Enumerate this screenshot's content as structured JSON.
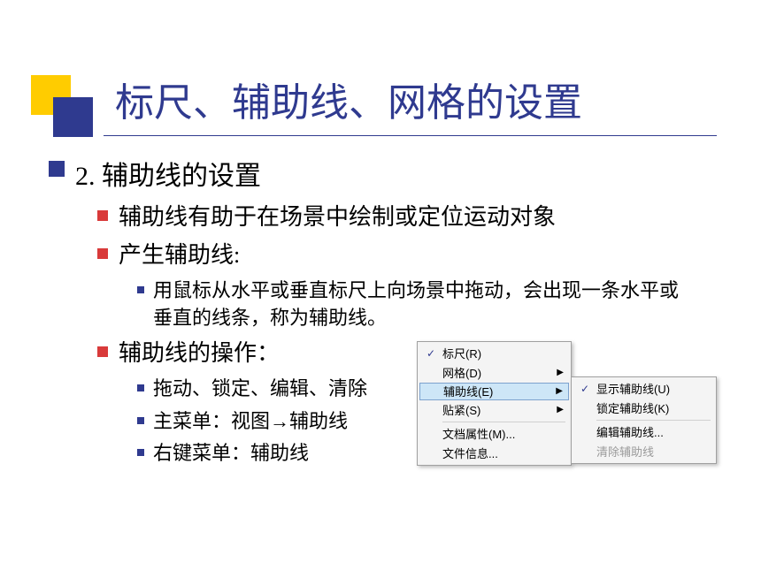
{
  "title": "标尺、辅助线、网格的设置",
  "section": {
    "number": "2.",
    "heading": "辅助线的设置"
  },
  "bullets": {
    "intro": "辅助线有助于在场景中绘制或定位运动对象",
    "generate_label": "产生辅助线:",
    "generate_desc": "用鼠标从水平或垂直标尺上向场景中拖动，会出现一条水平或垂直的线条，称为辅助线。",
    "ops_label": "辅助线的操作：",
    "ops_items": {
      "a": "拖动、锁定、编辑、清除",
      "b": "主菜单：视图→辅助线",
      "c": "右键菜单：辅助线"
    }
  },
  "menu_main": {
    "ruler": "标尺(R)",
    "grid": "网格(D)",
    "guides": "辅助线(E)",
    "snap": "贴紧(S)",
    "doc_props": "文档属性(M)...",
    "file_info": "文件信息..."
  },
  "menu_sub": {
    "show": "显示辅助线(U)",
    "lock": "锁定辅助线(K)",
    "edit": "编辑辅助线...",
    "clear": "清除辅助线"
  },
  "glyphs": {
    "check": "✓",
    "arrow": "▶"
  }
}
